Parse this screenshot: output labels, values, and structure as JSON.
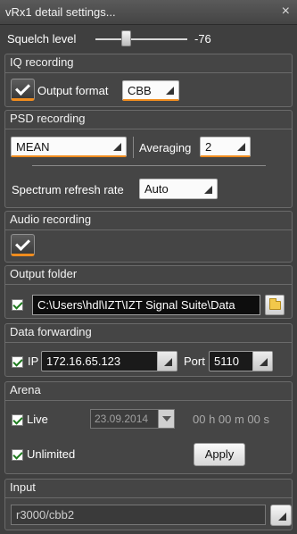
{
  "window": {
    "title": "vRx1 detail settings...",
    "close_label": "×"
  },
  "squelch": {
    "label": "Squelch level",
    "value": "-76",
    "level_fraction": 0.32
  },
  "iq_recording": {
    "title": "IQ recording",
    "output_format_label": "Output format",
    "output_format_value": "CBB",
    "output_format_checked": true
  },
  "psd_recording": {
    "title": "PSD recording",
    "mode_value": "MEAN",
    "averaging_label": "Averaging",
    "averaging_value": "2",
    "refresh_label": "Spectrum refresh rate",
    "refresh_value": "Auto"
  },
  "audio_recording": {
    "title": "Audio recording",
    "checked": true
  },
  "output_folder": {
    "title": "Output folder",
    "path": "C:\\Users\\hdl\\IZT\\IZT Signal Suite\\Data",
    "enabled": true
  },
  "data_forwarding": {
    "title": "Data forwarding",
    "ip_label": "IP",
    "ip_value": "172.16.65.123",
    "port_label": "Port",
    "port_value": "5110",
    "enabled": true
  },
  "arena": {
    "title": "Arena",
    "live_label": "Live",
    "live_checked": true,
    "date_value": "23.09.2014",
    "duration_text": "00 h  00 m  00 s",
    "unlimited_label": "Unlimited",
    "unlimited_checked": true,
    "apply_label": "Apply"
  },
  "input": {
    "title": "Input",
    "value": "r3000/cbb2"
  },
  "colors": {
    "accent": "#f08c1e",
    "background": "#3f3f3f",
    "check": "#1d7a1d"
  }
}
